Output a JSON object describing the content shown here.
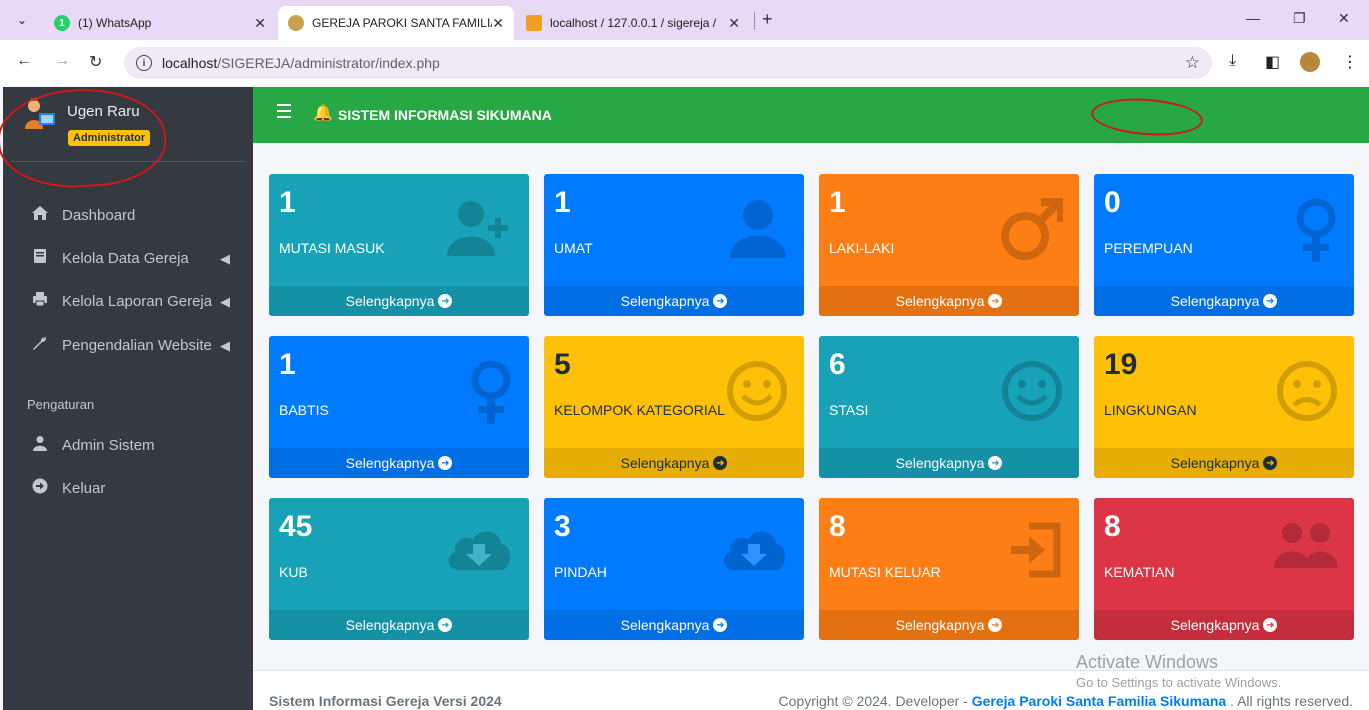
{
  "browser": {
    "tabs": [
      {
        "title": "(1) WhatsApp"
      },
      {
        "title": "GEREJA PAROKI SANTA FAMILIA"
      },
      {
        "title": "localhost / 127.0.0.1 / sigereja /"
      }
    ],
    "url_host": "localhost",
    "url_path": "/SIGEREJA/administrator/index.php"
  },
  "sidebar": {
    "user_name": "Ugen Raru",
    "role_badge": "Administrator",
    "items": [
      {
        "label": "Dashboard",
        "icon": "home-icon"
      },
      {
        "label": "Kelola Data Gereja",
        "icon": "book-icon"
      },
      {
        "label": "Kelola Laporan Gereja",
        "icon": "print-icon"
      },
      {
        "label": "Pengendalian Website",
        "icon": "wrench-icon"
      }
    ],
    "section_header": "Pengaturan",
    "settings": [
      {
        "label": "Admin Sistem",
        "icon": "user-icon"
      },
      {
        "label": "Keluar",
        "icon": "logout-icon"
      }
    ]
  },
  "header": {
    "title": "SISTEM INFORMASI SIKUMANA"
  },
  "boxes": [
    {
      "value": "1",
      "label": "MUTASI MASUK",
      "color": "#17a2b8",
      "icon": "user-plus-icon"
    },
    {
      "value": "1",
      "label": "UMAT",
      "color": "#007bff",
      "icon": "user-icon"
    },
    {
      "value": "1",
      "label": "LAKI-LAKI",
      "color": "#fd7e14",
      "icon": "male-icon"
    },
    {
      "value": "0",
      "label": "PEREMPUAN",
      "color": "#007bff",
      "icon": "female-icon"
    },
    {
      "value": "1",
      "label": "BABTIS",
      "color": "#007bff",
      "icon": "female-icon"
    },
    {
      "value": "5",
      "label": "KELOMPOK KATEGORIAL",
      "color": "#ffc107",
      "icon": "smile-icon"
    },
    {
      "value": "6",
      "label": "STASI",
      "color": "#17a2b8",
      "icon": "smile-icon"
    },
    {
      "value": "19",
      "label": "LINGKUNGAN",
      "color": "#ffc107",
      "icon": "sad-icon"
    },
    {
      "value": "45",
      "label": "KUB",
      "color": "#17a2b8",
      "icon": "cloud-download-icon"
    },
    {
      "value": "3",
      "label": "PINDAH",
      "color": "#007bff",
      "icon": "cloud-download-icon"
    },
    {
      "value": "8",
      "label": "MUTASI KELUAR",
      "color": "#fd7e14",
      "icon": "sign-in-icon"
    },
    {
      "value": "8",
      "label": "KEMATIAN",
      "color": "#dc3545",
      "icon": "users-icon"
    }
  ],
  "more_label": "Selengkapnya",
  "footer": {
    "left": "Sistem Informasi Gereja Versi 2024",
    "right_prefix": "Copyright © 2024. Developer - ",
    "right_link": "Gereja Paroki Santa Familia Sikumana",
    "right_suffix": " . All rights reserved."
  },
  "watermark": {
    "line1": "Activate Windows",
    "line2": "Go to Settings to activate Windows."
  }
}
